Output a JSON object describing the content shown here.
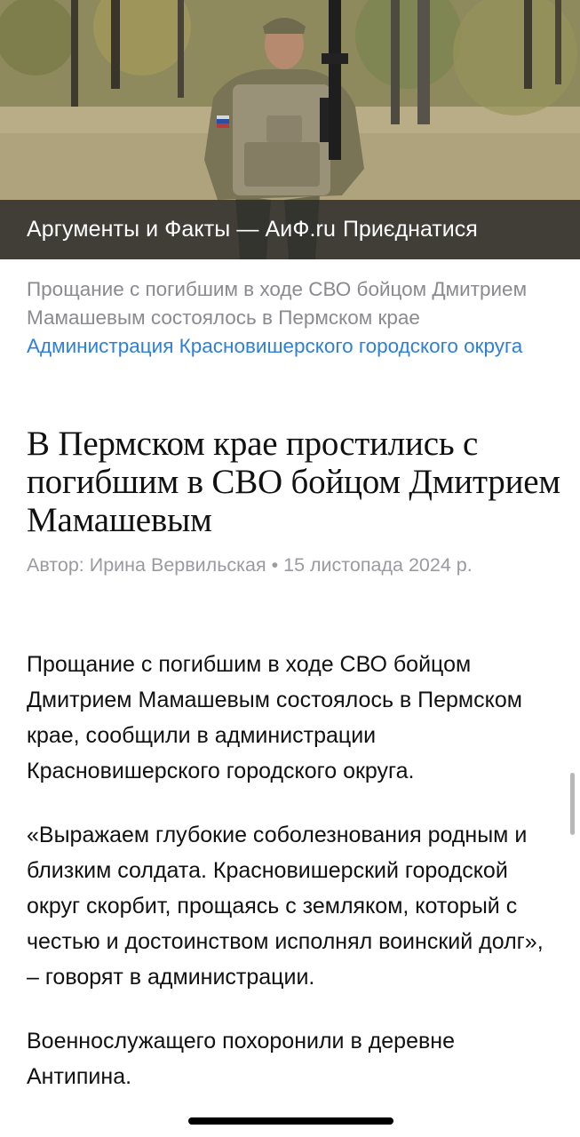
{
  "header": {
    "channel_title": "Аргументы и Факты — АиФ.ru",
    "join_label": "Приєднатися"
  },
  "hero_image": {
    "description_icon": "soldier-photo"
  },
  "caption": {
    "text": "Прощание с погибшим в ходе СВО бойцом Дмитрием Мамашевым состоялось в Пермском крае",
    "link_text": "Администрация Красновишерского городского округа"
  },
  "article": {
    "title": "В Пермском крае простились с погибшим в СВО бойцом Дмитрием Мамашевым",
    "byline": "Автор: Ирина Вервильская • 15 листопада 2024 р.",
    "paragraphs": [
      "Прощание с погибшим в ходе СВО бойцом Дмитрием Мамашевым состоялось в Пермском крае, сообщили в администрации Красновишерского городского округа.",
      "«Выражаем глубокие соболезнования родным и близким солдата. Красновишерский городской округ скорбит, прощаясь с земляком, который с честью и достоинством исполнял воинский долг», – говорят в администрации.",
      "Военнослужащего похоронили в деревне Антипина."
    ]
  },
  "colors": {
    "link": "#2f7fd4",
    "muted": "#8a8a8f",
    "overlay": "#282828"
  }
}
